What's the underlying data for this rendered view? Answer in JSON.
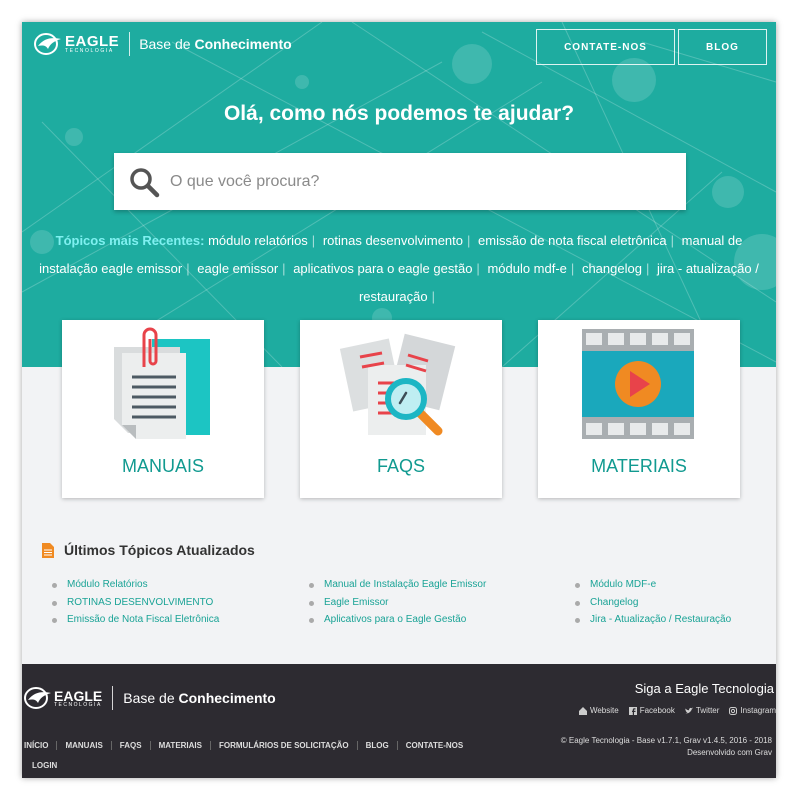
{
  "header": {
    "brand_name": "EAGLE",
    "brand_sub": "TECNOLOGIA",
    "site_prefix": "Base de ",
    "site_bold": "Conhecimento",
    "nav": [
      "CONTATE-NOS",
      "BLOG"
    ]
  },
  "hero": {
    "heading": "Olá, como nós podemos te ajudar?",
    "search_placeholder": "O que você procura?",
    "topics_label": "Tópicos mais Recentes:",
    "topics": [
      "módulo relatórios",
      "rotinas desenvolvimento",
      "emissão de nota fiscal eletrônica",
      "manual de instalação eagle emissor",
      "eagle emissor",
      "aplicativos para o eagle gestão",
      "módulo mdf-e",
      "changelog",
      "jira - atualização / restauração"
    ]
  },
  "cards": [
    {
      "label": "MANUAIS",
      "icon": "documents-clip-icon"
    },
    {
      "label": "FAQS",
      "icon": "magnifier-documents-icon"
    },
    {
      "label": "MATERIAIS",
      "icon": "film-play-icon"
    }
  ],
  "latest": {
    "title": "Últimos Tópicos Atualizados",
    "columns": [
      [
        "Módulo Relatórios",
        "ROTINAS DESENVOLVIMENTO",
        "Emissão de Nota Fiscal Eletrônica"
      ],
      [
        "Manual de Instalação Eagle Emissor",
        "Eagle Emissor",
        "Aplicativos para o Eagle Gestão"
      ],
      [
        "Módulo MDF-e",
        "Changelog",
        "Jira - Atualização / Restauração"
      ]
    ]
  },
  "footer": {
    "follow": "Siga a Eagle Tecnologia",
    "social": [
      "Website",
      "Facebook",
      "Twitter",
      "Instagram"
    ],
    "nav": [
      "INÍCIO",
      "MANUAIS",
      "FAQS",
      "MATERIAIS",
      "FORMULÁRIOS DE SOLICITAÇÃO",
      "BLOG",
      "CONTATE-NOS"
    ],
    "login": "LOGIN",
    "copyright": "© Eagle Tecnologia - Base v1.7.1, Grav v1.4.5, 2016 - 2018",
    "developed": "Desenvolvido com Grav"
  },
  "colors": {
    "accent": "#1eaca0",
    "link": "#1aa396",
    "footer_bg": "#2d2b31"
  }
}
